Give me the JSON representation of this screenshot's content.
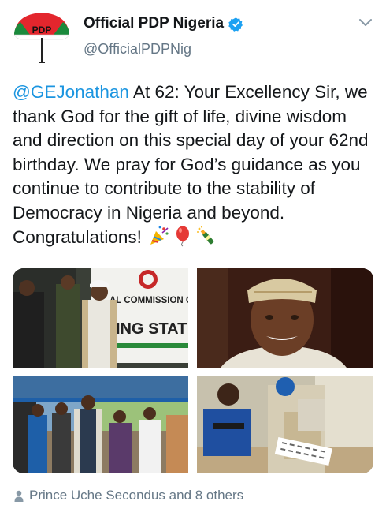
{
  "profile": {
    "display_name": "Official PDP Nigeria",
    "handle": "@OfficialPDPNig",
    "logo_text": "PDP",
    "verified": true
  },
  "tweet": {
    "mention": "@GEJonathan",
    "body": " At 62: Your Excellency Sir, we thank God for the gift of life, divine wisdom and direction on this special day of your 62nd birthday. We pray for God’s guidance as you continue to contribute to the stability of Democracy in Nigeria and beyond. Congratulations! ",
    "emojis": [
      "party-popper-icon",
      "balloon-icon",
      "champagne-icon"
    ]
  },
  "photos": [
    {
      "name": "photo-voting-center",
      "banner_line1": "AL COMMISSION OF",
      "banner_line2": "ING STAT"
    },
    {
      "name": "photo-portrait"
    },
    {
      "name": "photo-queue"
    },
    {
      "name": "photo-ballot"
    }
  ],
  "likers": {
    "text": "Prince Uche Secondus and 8 others"
  },
  "colors": {
    "accent": "#1b95e0",
    "muted": "#657786",
    "text": "#14171a",
    "pdp_red": "#e3262d",
    "pdp_green": "#1a8a3c"
  }
}
